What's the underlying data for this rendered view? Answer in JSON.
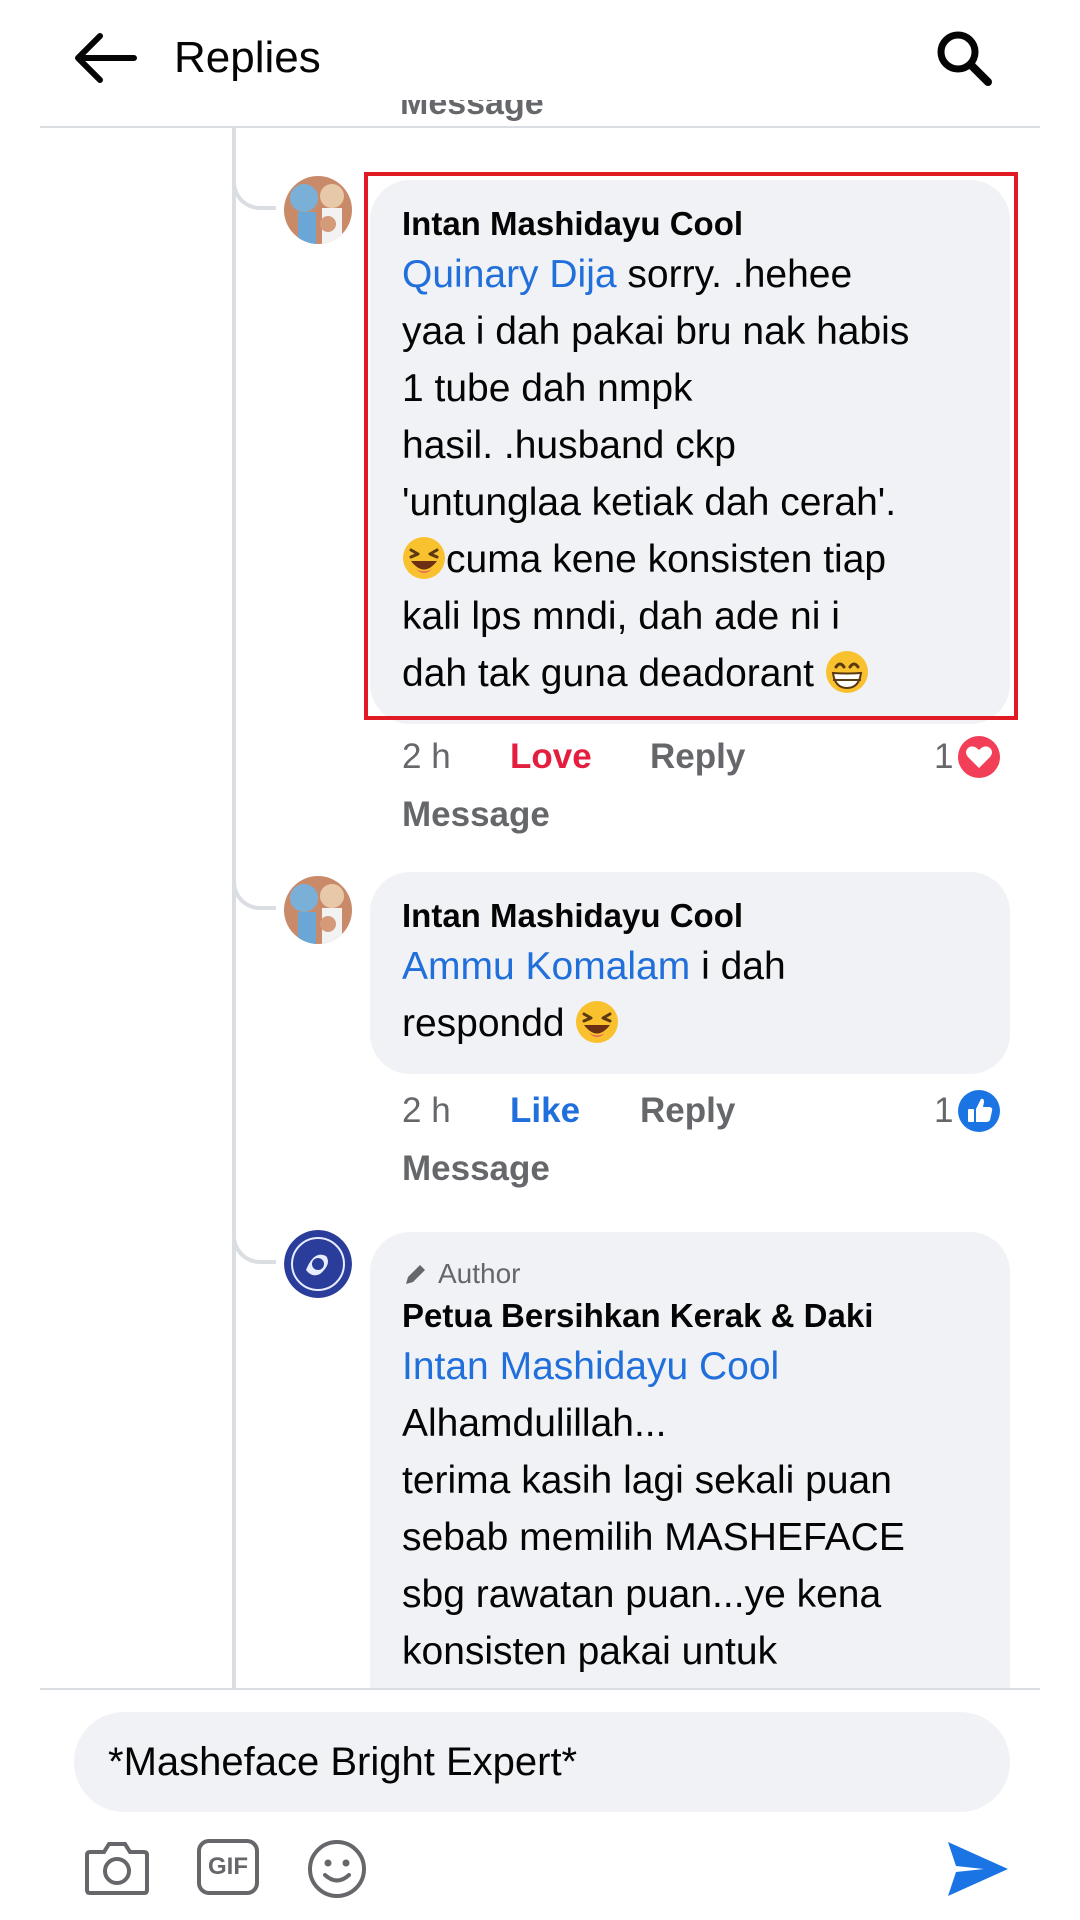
{
  "header": {
    "title": "Replies"
  },
  "truncated_text": "Message",
  "comments": [
    {
      "author": "Intan Mashidayu Cool",
      "mention": "Quinary Dija",
      "line1": " sorry.  .hehee",
      "lines": [
        "yaa i dah pakai bru nak habis",
        "1 tube dah nmpk",
        "hasil. .husband ckp",
        "'untunglaa ketiak dah cerah'."
      ],
      "line_after_emoji": "cuma kene konsisten tiap",
      "line7": "kali lps mndi, dah ade ni i",
      "line8": "dah tak guna deadorant ",
      "emoji1": "laughing-face",
      "emoji2": "grinning-face",
      "time": "2 h",
      "reaction_label": "Love",
      "reply_label": "Reply",
      "reaction_count": "1",
      "reaction_icon": "heart",
      "message_label": "Message"
    },
    {
      "author": "Intan Mashidayu Cool",
      "mention": "Ammu Komalam",
      "line1": " i dah",
      "line2": "respondd ",
      "emoji": "laughing-face",
      "time": "2 h",
      "reaction_label": "Like",
      "reply_label": "Reply",
      "reaction_count": "1",
      "reaction_icon": "thumbs-up",
      "message_label": "Message"
    },
    {
      "badge": "Author",
      "author": "Petua Bersihkan Kerak & Daki",
      "mention": "Intan Mashidayu Cool",
      "lines": [
        "Alhamdulillah...",
        "terima kasih lagi sekali puan",
        "sebab memilih MASHEFACE",
        "sbg rawatan puan...ye kena",
        "konsisten pakai untuk"
      ]
    }
  ],
  "composer": {
    "value": "*Masheface Bright Expert*",
    "gif_label": "GIF"
  },
  "colors": {
    "mention": "#216fdb",
    "love": "#e41e3f",
    "like": "#216fdb",
    "bubble": "#f0f2f5",
    "highlight": "#e01b24"
  }
}
